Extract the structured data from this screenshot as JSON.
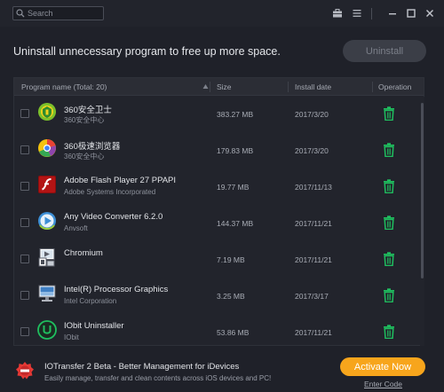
{
  "search": {
    "placeholder": "Search"
  },
  "header": {
    "message": "Uninstall unnecessary program to free up more space.",
    "uninstall_label": "Uninstall"
  },
  "table": {
    "columns": {
      "name": "Program name (Total: 20)",
      "size": "Size",
      "date": "Install date",
      "operation": "Operation"
    },
    "rows": [
      {
        "name": "360安全卫士",
        "publisher": "360安全中心",
        "size": "383.27 MB",
        "date": "2017/3/20",
        "icon": "360-safe-icon"
      },
      {
        "name": "360极速浏览器",
        "publisher": "360安全中心",
        "size": "179.83 MB",
        "date": "2017/3/20",
        "icon": "360-browser-icon"
      },
      {
        "name": "Adobe Flash Player 27 PPAPI",
        "publisher": "Adobe Systems Incorporated",
        "size": "19.77 MB",
        "date": "2017/11/13",
        "icon": "flash-icon"
      },
      {
        "name": "Any Video Converter 6.2.0",
        "publisher": "Anvsoft",
        "size": "144.37 MB",
        "date": "2017/11/21",
        "icon": "video-converter-icon"
      },
      {
        "name": "Chromium",
        "publisher": "",
        "size": "7.19 MB",
        "date": "2017/11/21",
        "icon": "chromium-icon"
      },
      {
        "name": "Intel(R) Processor Graphics",
        "publisher": "Intel Corporation",
        "size": "3.25 MB",
        "date": "2017/3/17",
        "icon": "intel-graphics-icon"
      },
      {
        "name": "IObit Uninstaller",
        "publisher": "IObit",
        "size": "53.86 MB",
        "date": "2017/11/21",
        "icon": "iobit-icon"
      }
    ]
  },
  "promo": {
    "title": "IOTransfer 2 Beta - Better Management for iDevices",
    "subtitle": "Easily manage, transfer and clean contents across iOS devices and PC!",
    "activate_label": "Activate Now",
    "enter_code_label": "Enter Code"
  },
  "colors": {
    "accent_green": "#1fbf5f",
    "activate_orange": "#f7a51c",
    "background": "#1f2129"
  }
}
